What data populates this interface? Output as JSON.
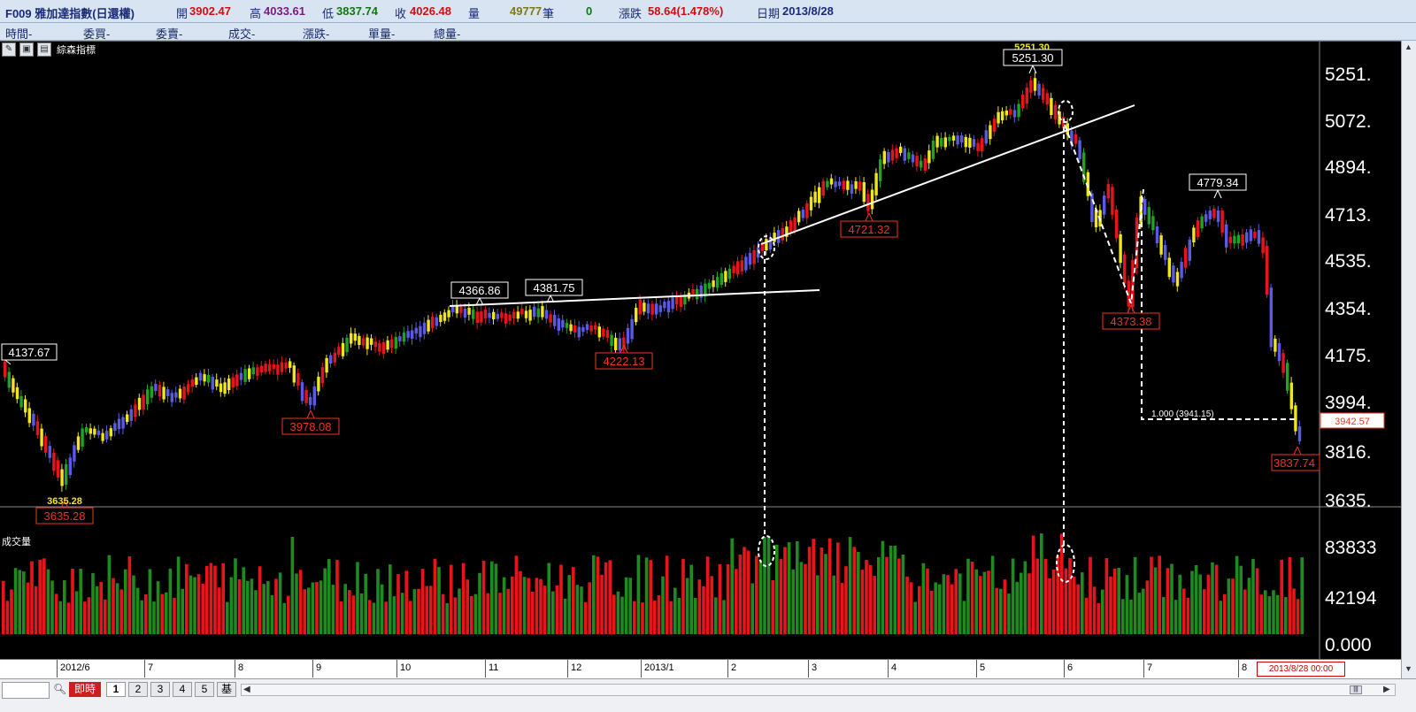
{
  "title_bar": {
    "symbol": "F009 雅加達指數(日還權)",
    "open_label": "開",
    "open_value": "3902.47",
    "high_label": "高",
    "high_value": "4033.61",
    "low_label": "低",
    "low_value": "3837.74",
    "close_label": "收",
    "close_value": "4026.48",
    "volume_label": "量",
    "volume_value": "49777",
    "trades_label": "筆",
    "trades_value": "0",
    "change_label": "漲跌",
    "change_value": "58.64(1.478%)",
    "date_label": "日期",
    "date_value": "2013/8/28"
  },
  "menu_bar": {
    "items": [
      "時間-",
      "委買-",
      "委賣-",
      "成交-",
      "漲跌-",
      "單量-",
      "總量-"
    ]
  },
  "chart_area": {
    "indicator_label": "綜森指標",
    "volume_label": "成交量",
    "price_axis": [
      "5251.",
      "5072.",
      "4894.",
      "4713.",
      "4535.",
      "4354.",
      "4175.",
      "3994.",
      "3816.",
      "3635."
    ],
    "volume_axis": [
      "83833",
      "42194",
      "0.000"
    ],
    "current_price_tag": "3942.57",
    "fib_label": "1.000 (3941.15)",
    "top_yellow_label": "5251.30",
    "bottom_yellow_label": "3635.28",
    "annotations": {
      "a4137": "4137.67",
      "a3635": "3635.28",
      "a3978": "3978.08",
      "a4366": "4366.86",
      "a4381": "4381.75",
      "a4222": "4222.13",
      "a4721": "4721.32",
      "a5251": "5251.30",
      "a4373": "4373.38",
      "a4779": "4779.34",
      "a3837": "3837.74"
    },
    "colors": {
      "up": "#e8141c",
      "down": "#5a5ae6",
      "yellow": "#f0e61e",
      "green": "#1fa51f",
      "vol_up": "#e8141c",
      "vol_down": "#1f8a1f"
    }
  },
  "x_axis": {
    "labels": [
      "2012/6",
      "7",
      "8",
      "9",
      "10",
      "11",
      "12",
      "2013/1",
      "2",
      "3",
      "4",
      "5",
      "6",
      "7",
      "8"
    ],
    "cursor_date": "2013/8/28 00:00"
  },
  "bottom_bar": {
    "realtime_label": "即時",
    "period_tabs": [
      "1",
      "2",
      "3",
      "4",
      "5",
      "基"
    ]
  }
}
